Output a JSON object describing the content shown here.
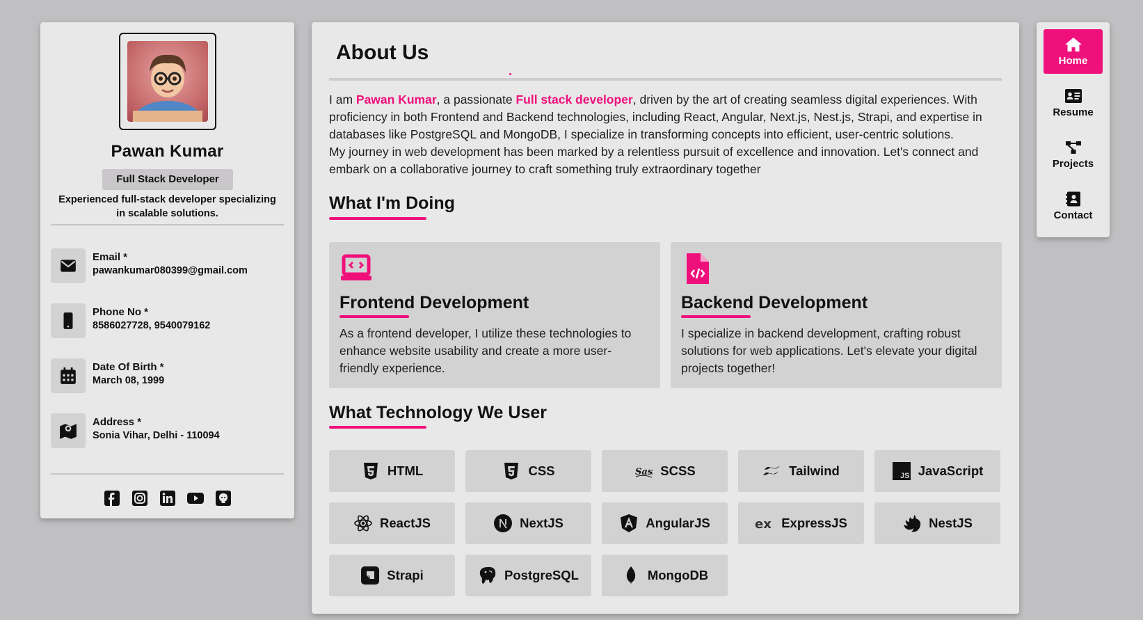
{
  "profile": {
    "name": "Pawan Kumar",
    "role": "Full Stack Developer",
    "tagline": "Experienced full-stack developer specializing in scalable solutions."
  },
  "contacts": [
    {
      "label": "Email *",
      "value": "pawankumar080399@gmail.com",
      "icon": "mail-icon"
    },
    {
      "label": "Phone No *",
      "value": "8586027728, 9540079162",
      "icon": "phone-icon"
    },
    {
      "label": "Date Of Birth *",
      "value": "March 08, 1999",
      "icon": "calendar-icon"
    },
    {
      "label": "Address *",
      "value": "Sonia Vihar, Delhi - 110094",
      "icon": "map-icon"
    }
  ],
  "socials": [
    "facebook-icon",
    "instagram-icon",
    "linkedin-icon",
    "youtube-icon",
    "github-icon"
  ],
  "about": {
    "title": "About Us",
    "p1_a": "I am ",
    "p1_name": "Pawan Kumar",
    "p1_b": ", a passionate ",
    "p1_role": "Full stack developer",
    "p1_c": ", driven by the art of creating seamless digital experiences. With proficiency in both Frontend and Backend technologies, including React, Angular, Next.js, Nest.js, Strapi, and expertise in databases like PostgreSQL and MongoDB, I specialize in transforming concepts into efficient, user-centric solutions.",
    "p2": "My journey in web development has been marked by a relentless pursuit of excellence and innovation. Let's connect and embark on a collaborative journey to craft something truly extraordinary together"
  },
  "doing": {
    "title": "What I'm Doing",
    "services": [
      {
        "title": "Frontend Development",
        "desc": "As a frontend developer, I utilize these technologies to enhance website usability and create a more user-friendly experience.",
        "icon": "laptop-code-icon"
      },
      {
        "title": "Backend Development",
        "desc": "I specialize in backend development, crafting robust solutions for web applications. Let's elevate your digital projects together!",
        "icon": "file-code-icon"
      }
    ]
  },
  "tech": {
    "title": "What Technology We User",
    "items": [
      "HTML",
      "CSS",
      "SCSS",
      "Tailwind",
      "JavaScript",
      "ReactJS",
      "NextJS",
      "AngularJS",
      "ExpressJS",
      "NestJS",
      "Strapi",
      "PostgreSQL",
      "MongoDB"
    ]
  },
  "nav": [
    {
      "label": "Home",
      "icon": "home-icon",
      "active": true
    },
    {
      "label": "Resume",
      "icon": "id-card-icon",
      "active": false
    },
    {
      "label": "Projects",
      "icon": "diagram-icon",
      "active": false
    },
    {
      "label": "Contact",
      "icon": "contact-book-icon",
      "active": false
    }
  ],
  "colors": {
    "accent": "#f0107c",
    "background": "#c0bfc1",
    "card": "#e9e8e9",
    "tile": "#d3d2d3"
  }
}
